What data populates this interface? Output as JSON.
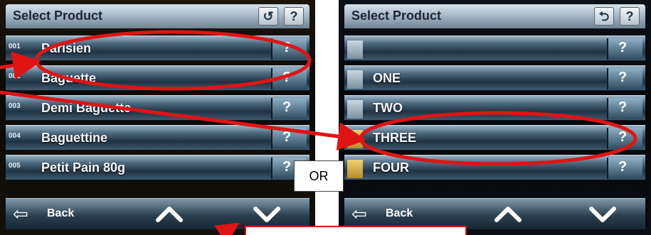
{
  "left_screen": {
    "title": "Select Product",
    "undo_icon": "undo-icon",
    "help_label": "?",
    "rows": [
      {
        "num": "001",
        "label": "Parisien"
      },
      {
        "num": "002",
        "label": "Baguette"
      },
      {
        "num": "003",
        "label": "Demi Baguette"
      },
      {
        "num": "004",
        "label": "Baguettine"
      },
      {
        "num": "005",
        "label": "Petit Pain 80g"
      }
    ],
    "back_label": "Back"
  },
  "right_screen": {
    "title": "Select Product",
    "help_label": "?",
    "rows": [
      {
        "label": ""
      },
      {
        "label": "ONE"
      },
      {
        "label": "TWO"
      },
      {
        "label": "THREE"
      },
      {
        "label": "FOUR"
      }
    ],
    "back_label": "Back"
  },
  "info_glyph": "?",
  "or_label": "OR",
  "annotation_color": "#e01414"
}
